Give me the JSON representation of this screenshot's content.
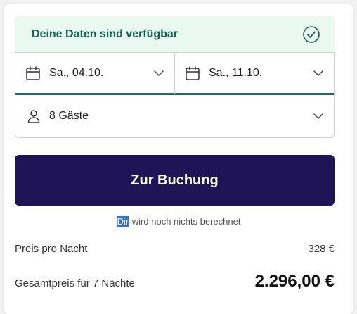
{
  "availability": {
    "text": "Deine Daten sind verfügbar",
    "icon": "check-circle-icon",
    "color": "#16604e"
  },
  "dates": {
    "checkin": "Sa., 04.10.",
    "checkout": "Sa., 11.10."
  },
  "guests": {
    "value": "8 Gäste"
  },
  "booking": {
    "button_label": "Zur Buchung",
    "button_color": "#1e1456"
  },
  "note": {
    "highlight": "Dir",
    "rest": " wird noch nichts berechnet"
  },
  "pricing": {
    "per_night_label": "Preis pro Nacht",
    "per_night_value": "328 €",
    "total_label": "Gesamtpreis für 7 Nächte",
    "total_value": "2.296,00 €"
  }
}
